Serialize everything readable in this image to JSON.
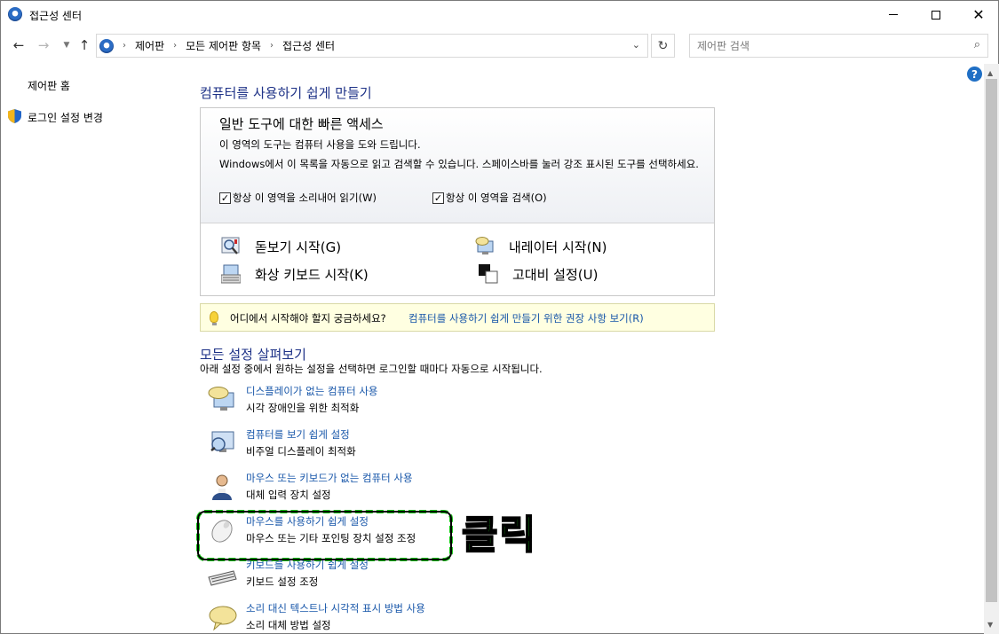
{
  "window": {
    "title": "접근성 센터",
    "icons": {
      "app": "ease-of-access-icon",
      "minimize": "minimize-icon",
      "maximize": "maximize-icon",
      "close": "close-icon"
    }
  },
  "address_bar": {
    "breadcrumbs": [
      "제어판",
      "모든 제어판 항목",
      "접근성 센터"
    ],
    "search_placeholder": "제어판 검색"
  },
  "left_pane": {
    "items": [
      {
        "label": "제어판 홈"
      },
      {
        "label": "로그인 설정 변경",
        "icon": "shield-icon"
      }
    ]
  },
  "main": {
    "heading": "컴퓨터를 사용하기 쉽게 만들기",
    "quick_access": {
      "title": "일반 도구에 대한 빠른 액세스",
      "desc1": "이 영역의 도구는 컴퓨터 사용을 도와 드립니다.",
      "desc2": "Windows에서 이 목록을 자동으로 읽고 검색할 수 있습니다. 스페이스바를 눌러 강조 표시된 도구를 선택하세요.",
      "checkbox_read": "항상 이 영역을 소리내어 읽기(W)",
      "checkbox_scan": "항상 이 영역을 검색(O)",
      "tools": {
        "magnifier": "돋보기 시작(G)",
        "narrator": "내레이터 시작(N)",
        "keyboard": "화상 키보드 시작(K)",
        "contrast": "고대비 설정(U)"
      }
    },
    "tip": {
      "question": "어디에서 시작해야 할지 궁금하세요?",
      "link": "컴퓨터를 사용하기 쉽게 만들기 위한 권장 사항 보기(R)"
    },
    "explore_heading": "모든 설정 살펴보기",
    "explore_desc": "아래 설정 중에서 원하는 설정을 선택하면 로그인할 때마다 자동으로 시작됩니다.",
    "settings": [
      {
        "title": "디스플레이가 없는 컴퓨터 사용",
        "desc": "시각 장애인을 위한 최적화",
        "icon": "speech-monitor-icon"
      },
      {
        "title": "컴퓨터를 보기 쉽게 설정",
        "desc": "비주얼 디스플레이 최적화",
        "icon": "monitor-magnifier-icon"
      },
      {
        "title": "마우스 또는 키보드가 없는 컴퓨터 사용",
        "desc": "대체 입력 장치 설정",
        "icon": "person-icon"
      },
      {
        "title": "마우스를 사용하기 쉽게 설정",
        "desc": "마우스 또는 기타 포인팅 장치 설정 조정",
        "icon": "mouse-icon"
      },
      {
        "title": "키보드를 사용하기 쉽게 설정",
        "desc": "키보드 설정 조정",
        "icon": "keyboard-icon"
      },
      {
        "title": "소리 대신 텍스트나 시각적 표시 방법 사용",
        "desc": "소리 대체 방법 설정",
        "icon": "speech-bubble-icon"
      }
    ]
  },
  "annotation": {
    "text": "클릭"
  },
  "colors": {
    "link": "#1756a9",
    "heading": "#1e3287",
    "annotation": "#1ed21e"
  }
}
